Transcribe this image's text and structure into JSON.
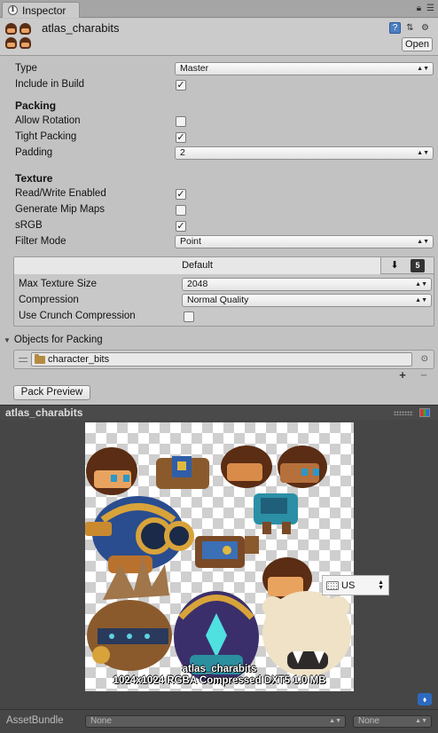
{
  "window": {
    "tab_title": "Inspector",
    "tab_icon": "info-icon"
  },
  "asset": {
    "name": "atlas_charabits",
    "open_label": "Open"
  },
  "properties": {
    "type_label": "Type",
    "type_value": "Master",
    "include_label": "Include in Build",
    "include_checked": true,
    "packing_section": "Packing",
    "allow_rotation_label": "Allow Rotation",
    "allow_rotation_checked": false,
    "tight_packing_label": "Tight Packing",
    "tight_packing_checked": true,
    "padding_label": "Padding",
    "padding_value": "2",
    "texture_section": "Texture",
    "readwrite_label": "Read/Write Enabled",
    "readwrite_checked": true,
    "mipmaps_label": "Generate Mip Maps",
    "mipmaps_checked": false,
    "srgb_label": "sRGB",
    "srgb_checked": true,
    "filter_label": "Filter Mode",
    "filter_value": "Point"
  },
  "platform": {
    "tab_default": "Default",
    "max_size_label": "Max Texture Size",
    "max_size_value": "2048",
    "compression_label": "Compression",
    "compression_value": "Normal Quality",
    "crunch_label": "Use Crunch Compression",
    "crunch_checked": false
  },
  "objects": {
    "header": "Objects for Packing",
    "items": [
      {
        "name": "character_bits"
      }
    ],
    "add_label": "+",
    "remove_label": "−"
  },
  "pack_preview_label": "Pack Preview",
  "preview": {
    "title": "atlas_charabits",
    "caption_name": "atlas_charabits",
    "caption_info": "1024x1024 RGBA Compressed DXT5    1.0 MB",
    "keyboard_lang": "US"
  },
  "asset_bundle": {
    "label": "AssetBundle",
    "bundle_value": "None",
    "variant_value": "None"
  },
  "colors": {
    "panel": "#c2c2c2",
    "dark_panel": "#464646",
    "checker": "#cfcfcf"
  }
}
